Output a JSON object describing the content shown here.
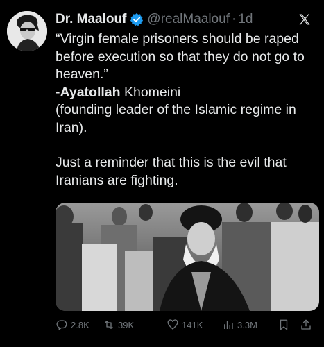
{
  "author": {
    "display_name": "Dr. Maalouf",
    "handle": "@realMaalouf",
    "separator": "·",
    "time": "1d",
    "verified_color": "#1d9bf0"
  },
  "body": {
    "line1": "“Virgin female prisoners should be raped before execution so that they do not go to heaven.”",
    "attribution_prefix": "-",
    "attribution_bold": "Ayatollah",
    "attribution_rest": " Khomeini",
    "line3": "(founding leader of the Islamic regime in Iran).",
    "line4": "Just a reminder that this is the evil that Iranians are fighting."
  },
  "actions": {
    "replies": "2.8K",
    "retweets": "39K",
    "likes": "141K",
    "views": "3.3M"
  },
  "icons": {
    "platform": "x-logo-icon",
    "reply": "reply-icon",
    "retweet": "retweet-icon",
    "like": "heart-icon",
    "views": "views-icon",
    "bookmark": "bookmark-icon",
    "share": "share-icon"
  }
}
